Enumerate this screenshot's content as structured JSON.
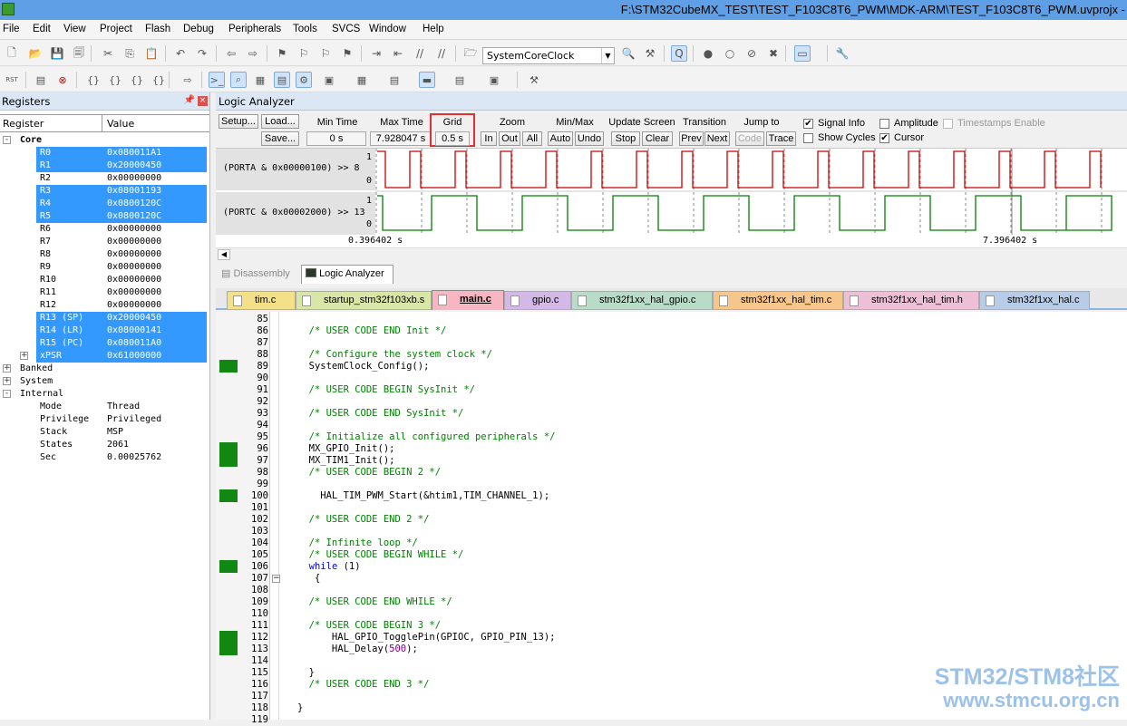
{
  "title": "F:\\STM32CubeMX_TEST\\TEST_F103C8T6_PWM\\MDK-ARM\\TEST_F103C8T6_PWM.uvprojx -",
  "menu": [
    "File",
    "Edit",
    "View",
    "Project",
    "Flash",
    "Debug",
    "Peripherals",
    "Tools",
    "SVCS",
    "Window",
    "Help"
  ],
  "toolbar": {
    "target_combo": "SystemCoreClock"
  },
  "registers": {
    "title": "Registers",
    "col_register": "Register",
    "col_value": "Value",
    "core_label": "Core",
    "core": [
      {
        "name": "R0",
        "value": "0x080011A1",
        "selected": true
      },
      {
        "name": "R1",
        "value": "0x20000450",
        "selected": true
      },
      {
        "name": "R2",
        "value": "0x00000000",
        "selected": false
      },
      {
        "name": "R3",
        "value": "0x08001193",
        "selected": true
      },
      {
        "name": "R4",
        "value": "0x0800120C",
        "selected": true
      },
      {
        "name": "R5",
        "value": "0x0800120C",
        "selected": true
      },
      {
        "name": "R6",
        "value": "0x00000000",
        "selected": false
      },
      {
        "name": "R7",
        "value": "0x00000000",
        "selected": false
      },
      {
        "name": "R8",
        "value": "0x00000000",
        "selected": false
      },
      {
        "name": "R9",
        "value": "0x00000000",
        "selected": false
      },
      {
        "name": "R10",
        "value": "0x00000000",
        "selected": false
      },
      {
        "name": "R11",
        "value": "0x00000000",
        "selected": false
      },
      {
        "name": "R12",
        "value": "0x00000000",
        "selected": false
      },
      {
        "name": "R13 (SP)",
        "value": "0x20000450",
        "selected": true
      },
      {
        "name": "R14 (LR)",
        "value": "0x08000141",
        "selected": true
      },
      {
        "name": "R15 (PC)",
        "value": "0x080011A0",
        "selected": true
      },
      {
        "name": "xPSR",
        "value": "0x61000000",
        "selected": true
      }
    ],
    "groups": [
      "Banked",
      "System",
      "Internal"
    ],
    "internal": [
      {
        "name": "Mode",
        "value": "Thread"
      },
      {
        "name": "Privilege",
        "value": "Privileged"
      },
      {
        "name": "Stack",
        "value": "MSP"
      },
      {
        "name": "States",
        "value": "2061"
      },
      {
        "name": "Sec",
        "value": "0.00025762"
      }
    ]
  },
  "logic_analyzer": {
    "title": "Logic Analyzer",
    "setup": "Setup...",
    "load": "Load...",
    "save": "Save...",
    "min_time_label": "Min Time",
    "min_time": "0 s",
    "max_time_label": "Max Time",
    "max_time": "7.928047 s",
    "grid_label": "Grid",
    "grid": "0.5 s",
    "zoom_label": "Zoom",
    "zoom_in": "In",
    "zoom_out": "Out",
    "zoom_all": "All",
    "minmax_label": "Min/Max",
    "auto": "Auto",
    "undo": "Undo",
    "update_label": "Update Screen",
    "stop": "Stop",
    "clear": "Clear",
    "transition_label": "Transition",
    "prev": "Prev",
    "next": "Next",
    "jump_label": "Jump to",
    "code": "Code",
    "trace": "Trace",
    "signal_info": "Signal Info",
    "show_cycles": "Show Cycles",
    "amplitude": "Amplitude",
    "cursor": "Cursor",
    "timestamps": "Timestamps Enable",
    "signals": [
      {
        "expr": "(PORTA & 0x00000100) >> 8",
        "high": "1",
        "low": "0",
        "color": "#cc0000"
      },
      {
        "expr": "(PORTC & 0x00002000) >> 13",
        "high": "1",
        "low": "0",
        "color": "#008000"
      }
    ],
    "time_left": "0.396402 s",
    "time_right": "7.396402 s"
  },
  "view_tabs": [
    "Disassembly",
    "Logic Analyzer"
  ],
  "file_tabs": [
    {
      "name": "tim.c",
      "color": "#f5e08a"
    },
    {
      "name": "startup_stm32f103xb.s",
      "color": "#d8e6a8"
    },
    {
      "name": "main.c",
      "color": "#f7b6c2",
      "active": true
    },
    {
      "name": "gpio.c",
      "color": "#d4b8e8"
    },
    {
      "name": "stm32f1xx_hal_gpio.c",
      "color": "#b8dcc8"
    },
    {
      "name": "stm32f1xx_hal_tim.c",
      "color": "#f7c68a"
    },
    {
      "name": "stm32f1xx_hal_tim.h",
      "color": "#eec0d8"
    },
    {
      "name": "stm32f1xx_hal.c",
      "color": "#b8cce8"
    }
  ],
  "code_lines": [
    {
      "n": "85",
      "t": ""
    },
    {
      "n": "86",
      "t": "  /* USER CODE END Init */",
      "c": "cm"
    },
    {
      "n": "87",
      "t": ""
    },
    {
      "n": "88",
      "t": "  /* Configure the system clock */",
      "c": "cm"
    },
    {
      "n": "89",
      "t": "  SystemClock_Config();",
      "bp": true
    },
    {
      "n": "90",
      "t": ""
    },
    {
      "n": "91",
      "t": "  /* USER CODE BEGIN SysInit */",
      "c": "cm"
    },
    {
      "n": "92",
      "t": ""
    },
    {
      "n": "93",
      "t": "  /* USER CODE END SysInit */",
      "c": "cm"
    },
    {
      "n": "94",
      "t": ""
    },
    {
      "n": "95",
      "t": "  /* Initialize all configured peripherals */",
      "c": "cm"
    },
    {
      "n": "96",
      "t": "  MX_GPIO_Init();",
      "bp": true
    },
    {
      "n": "97",
      "t": "  MX_TIM1_Init();",
      "bp": true
    },
    {
      "n": "98",
      "t": "  /* USER CODE BEGIN 2 */",
      "c": "cm"
    },
    {
      "n": "99",
      "t": ""
    },
    {
      "n": "100",
      "t": "    HAL_TIM_PWM_Start(&htim1,TIM_CHANNEL_1);",
      "bp": true
    },
    {
      "n": "101",
      "t": ""
    },
    {
      "n": "102",
      "t": "  /* USER CODE END 2 */",
      "c": "cm"
    },
    {
      "n": "103",
      "t": ""
    },
    {
      "n": "104",
      "t": "  /* Infinite loop */",
      "c": "cm"
    },
    {
      "n": "105",
      "t": "  /* USER CODE BEGIN WHILE */",
      "c": "cm"
    },
    {
      "n": "106",
      "t": "  while (1)",
      "c": "while",
      "bp": true
    },
    {
      "n": "107",
      "t": "   {",
      "fold": true
    },
    {
      "n": "108",
      "t": ""
    },
    {
      "n": "109",
      "t": "  /* USER CODE END WHILE */",
      "c": "cm"
    },
    {
      "n": "110",
      "t": ""
    },
    {
      "n": "111",
      "t": "  /* USER CODE BEGIN 3 */",
      "c": "cm"
    },
    {
      "n": "112",
      "t": "      HAL_GPIO_TogglePin(GPIOC, GPIO_PIN_13);",
      "bp": true
    },
    {
      "n": "113",
      "t": "      HAL_Delay(500);",
      "c": "delay",
      "bp": true
    },
    {
      "n": "114",
      "t": ""
    },
    {
      "n": "115",
      "t": "  }"
    },
    {
      "n": "116",
      "t": "  /* USER CODE END 3 */",
      "c": "cm"
    },
    {
      "n": "117",
      "t": ""
    },
    {
      "n": "118",
      "t": "}"
    },
    {
      "n": "119",
      "t": ""
    }
  ],
  "watermark": {
    "line1": "STM32/STM8社区",
    "line2": "www.stmcu.org.cn"
  }
}
